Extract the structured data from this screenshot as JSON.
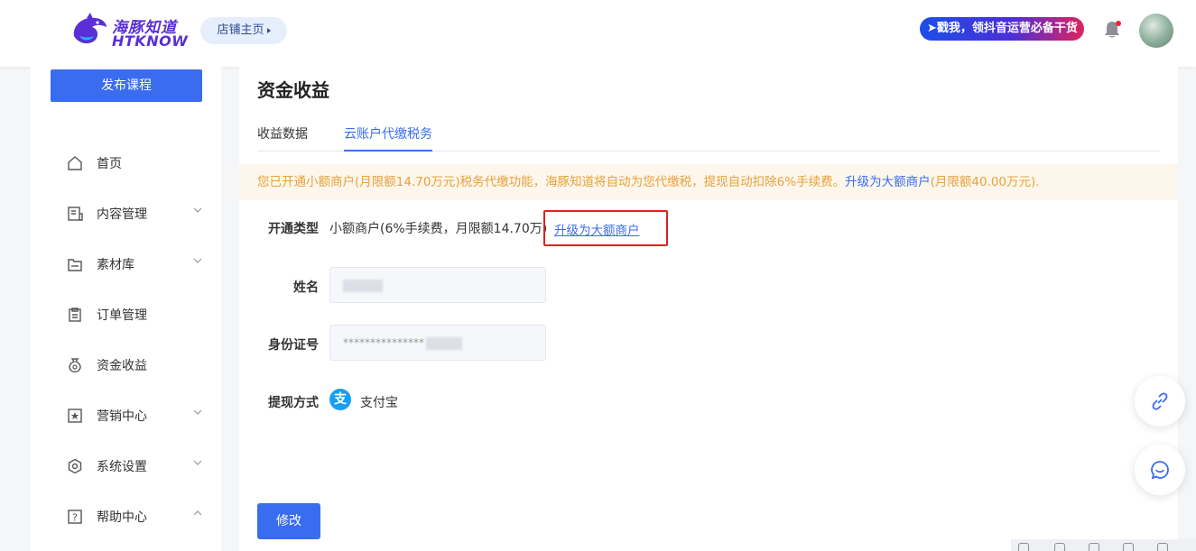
{
  "header": {
    "logo_cn": "海豚知道",
    "logo_en": "HTKNOW",
    "shop_home": "店铺主页",
    "promo": "戳我，领抖音运营必备干货",
    "colors": {
      "brand": "#5a2fd6",
      "accent": "#3a6cf0"
    }
  },
  "sidebar": {
    "publish_button": "发布课程",
    "items": [
      {
        "label": "首页",
        "icon": "home-icon",
        "expandable": false
      },
      {
        "label": "内容管理",
        "icon": "content-icon",
        "expandable": true
      },
      {
        "label": "素材库",
        "icon": "folder-icon",
        "expandable": true
      },
      {
        "label": "订单管理",
        "icon": "order-icon",
        "expandable": false
      },
      {
        "label": "资金收益",
        "icon": "money-bag-icon",
        "expandable": false
      },
      {
        "label": "营销中心",
        "icon": "star-icon",
        "expandable": true
      },
      {
        "label": "系统设置",
        "icon": "gear-icon",
        "expandable": true
      },
      {
        "label": "帮助中心",
        "icon": "help-icon",
        "expandable": true
      }
    ]
  },
  "main": {
    "title": "资金收益",
    "tabs": [
      {
        "label": "收益数据",
        "active": false
      },
      {
        "label": "云账户代缴税务",
        "active": true
      }
    ],
    "notice": {
      "text": "您已开通小额商户(月限额14.70万元)税务代缴功能，海豚知道将自动为您代缴税，提现自动扣除6%手续费。",
      "link": "升级为大额商户",
      "suffix": "(月限额40.00万元)."
    },
    "form": {
      "type_label": "开通类型",
      "type_value": "小额商户(6%手续费，月限额14.70万)",
      "upgrade_link": "升级为大额商户",
      "name_label": "姓名",
      "id_label": "身份证号",
      "id_value": "***************",
      "withdraw_label": "提现方式",
      "withdraw_value": "支付宝",
      "alipay_glyph": "支"
    },
    "edit_button": "修改"
  }
}
